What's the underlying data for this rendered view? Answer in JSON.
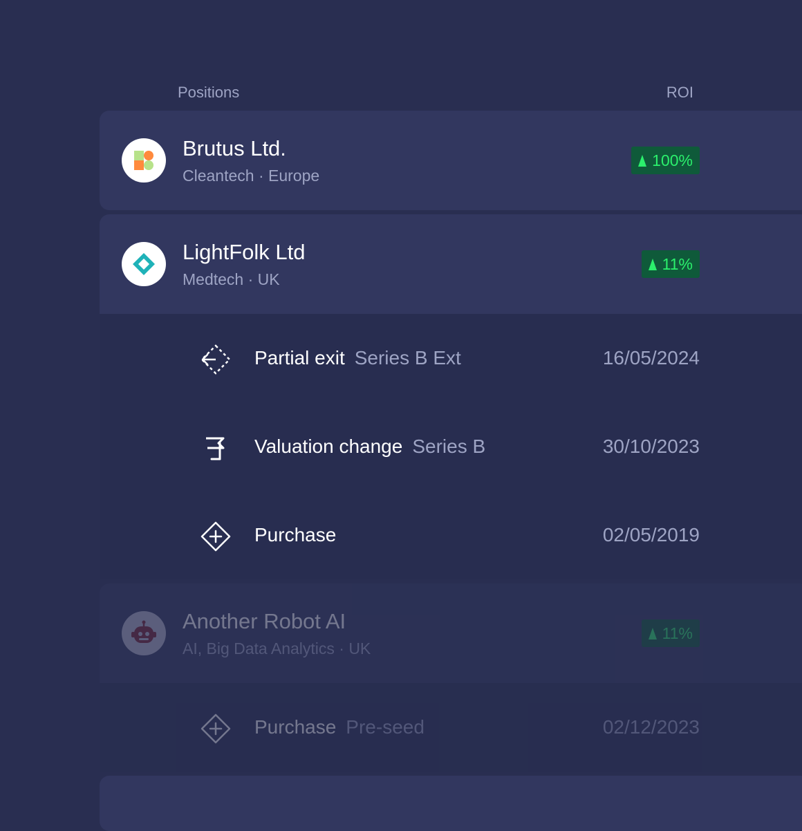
{
  "header": {
    "positions": "Positions",
    "roi": "ROI"
  },
  "positions": [
    {
      "name": "Brutus Ltd.",
      "subtitle": "Cleantech · Europe",
      "roi": "100%",
      "icon": "brutus-logo-icon"
    },
    {
      "name": "LightFolk Ltd",
      "subtitle": "Medtech · UK",
      "roi": "11%",
      "icon": "lightfolk-logo-icon",
      "events": [
        {
          "title": "Partial exit",
          "stage": "Series B Ext",
          "date": "16/05/2024",
          "icon": "partial-exit-icon"
        },
        {
          "title": "Valuation change",
          "stage": "Series B",
          "date": "30/10/2023",
          "icon": "flag-icon"
        },
        {
          "title": "Purchase",
          "stage": "",
          "date": "02/05/2019",
          "icon": "purchase-icon"
        }
      ]
    },
    {
      "name": "Another Robot AI",
      "subtitle": "AI, Big Data Analytics · UK",
      "roi": "11%",
      "icon": "robot-logo-icon",
      "events": [
        {
          "title": "Purchase",
          "stage": "Pre-seed",
          "date": "02/12/2023",
          "icon": "purchase-icon"
        }
      ]
    }
  ],
  "colors": {
    "background": "#292e51",
    "card": "#32375f",
    "roi_text": "#2bf06c",
    "roi_bg": "#0f5a3a",
    "muted": "#9ea4c4"
  }
}
